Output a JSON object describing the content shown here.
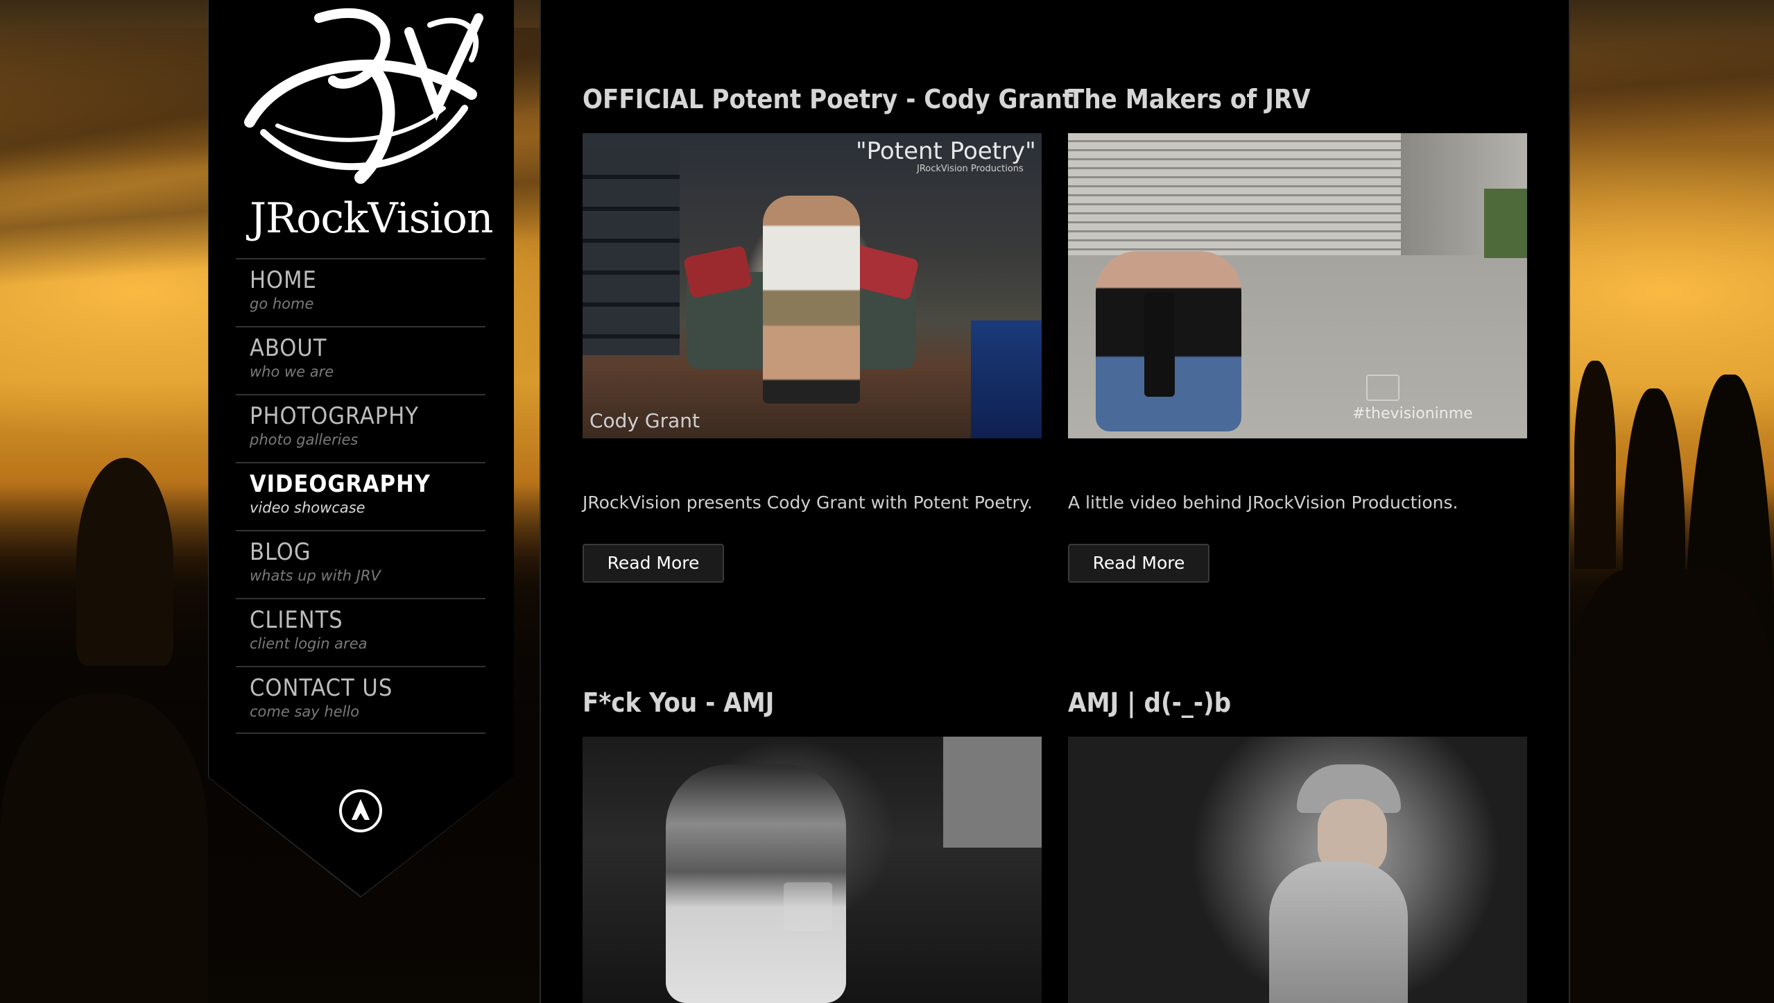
{
  "site": {
    "logo_text": "JRockVision",
    "logo_monogram": "JRV"
  },
  "nav": [
    {
      "label": "HOME",
      "sub": "go home",
      "active": false
    },
    {
      "label": "ABOUT",
      "sub": "who we are",
      "active": false
    },
    {
      "label": "PHOTOGRAPHY",
      "sub": "photo galleries",
      "active": false
    },
    {
      "label": "VIDEOGRAPHY",
      "sub": "video showcase",
      "active": true
    },
    {
      "label": "BLOG",
      "sub": "whats up with JRV",
      "active": false
    },
    {
      "label": "CLIENTS",
      "sub": "client login area",
      "active": false
    },
    {
      "label": "CONTACT US",
      "sub": "come say hello",
      "active": false
    }
  ],
  "posts": [
    {
      "title": "OFFICIAL Potent Poetry - Cody Grant",
      "excerpt": "JRockVision presents Cody Grant with Potent Poetry.",
      "read_more": "Read More",
      "thumb_title": "\"Potent Poetry\"",
      "thumb_credit": "JRockVision Productions",
      "thumb_name": "Cody Grant"
    },
    {
      "title": "The Makers of JRV",
      "excerpt": "A little video behind JRockVision Productions.",
      "read_more": "Read More",
      "thumb_tag": "#thevisioninme"
    },
    {
      "title": "F*ck You - AMJ"
    },
    {
      "title": "AMJ | d(-_-)b"
    }
  ],
  "colors": {
    "accent": "#ffffff",
    "nav_text": "#bdbdbd",
    "nav_sub": "#7a7a7a",
    "panel_bg": "#000000",
    "sky_orange": "#d89a2c"
  },
  "icons": {
    "back_to_top": "navigation-arrow-icon"
  }
}
